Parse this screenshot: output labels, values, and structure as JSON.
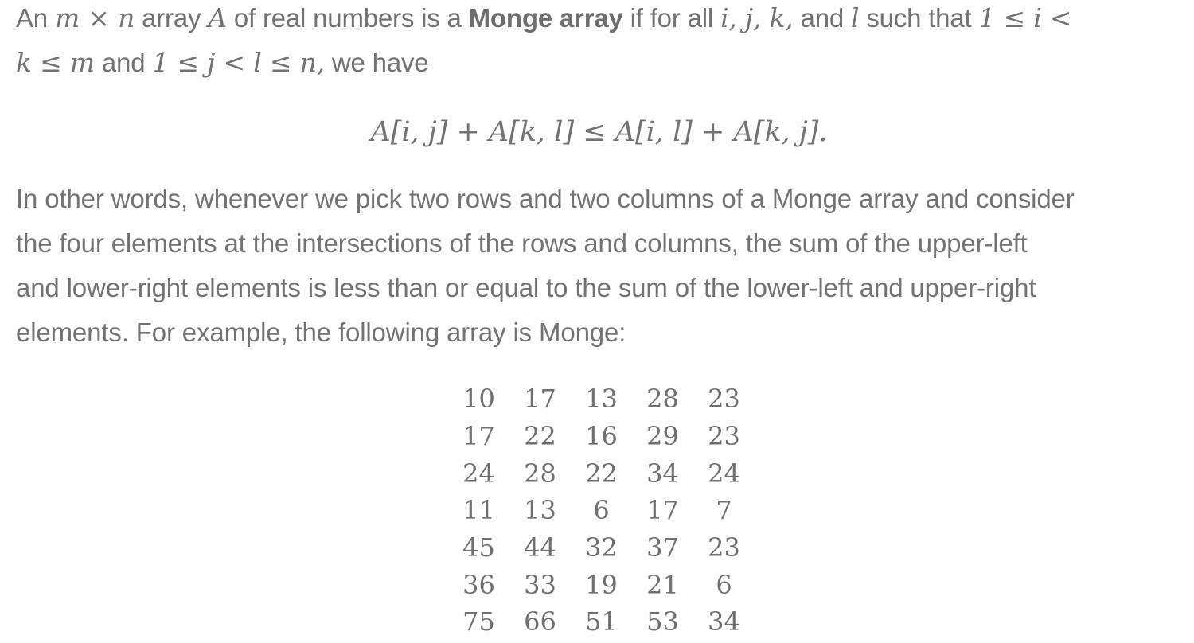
{
  "intro": {
    "t1": "An ",
    "m": "m",
    "times": " × ",
    "n": "n",
    "t2": " array ",
    "A": "A",
    "t3": " of real numbers is a ",
    "term": "Monge array",
    "t4": " if for all ",
    "vars": "i, j, k,",
    "t5": " and ",
    "l": "l",
    "t6": " such that ",
    "cond1a": "1 ≤ i <",
    "cond1b": "k ≤ m",
    "t7": " and ",
    "cond2": "1 ≤ j < l ≤ n,",
    "t8": " we have"
  },
  "equation": "A[i, j] + A[k, l] ≤ A[i, l] + A[k, j].",
  "paragraph2": {
    "lines": [
      "In other words, whenever we pick two rows and two columns of a Monge array and consider",
      "the four elements at the intersections of the rows and columns, the sum of the upper-left",
      "and lower-right elements is less than or equal to the sum of the lower-left and upper-right",
      "elements. For example, the following array is Monge:"
    ]
  },
  "table": {
    "rows": [
      [
        "10",
        "17",
        "13",
        "28",
        "23"
      ],
      [
        "17",
        "22",
        "16",
        "29",
        "23"
      ],
      [
        "24",
        "28",
        "22",
        "34",
        "24"
      ],
      [
        "11",
        "13",
        "6",
        "17",
        "7"
      ],
      [
        "45",
        "44",
        "32",
        "37",
        "23"
      ],
      [
        "36",
        "33",
        "19",
        "21",
        "6"
      ],
      [
        "75",
        "66",
        "51",
        "53",
        "34"
      ]
    ]
  }
}
